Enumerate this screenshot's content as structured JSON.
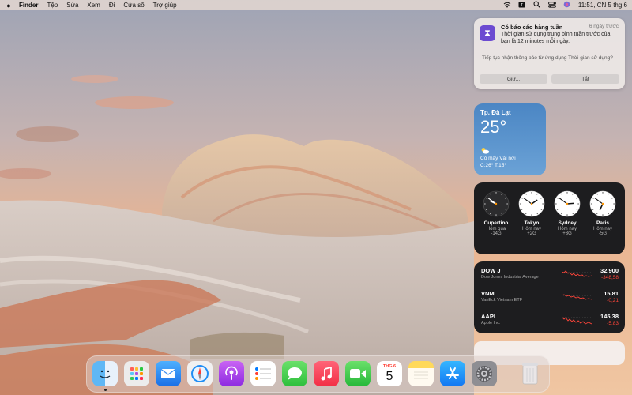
{
  "menubar": {
    "apple_icon": "apple-icon",
    "app_name": "Finder",
    "menus": [
      "Tệp",
      "Sửa",
      "Xem",
      "Đi",
      "Cửa sổ",
      "Trợ giúp"
    ],
    "status_icons": [
      "wifi-icon",
      "search-icon",
      "control-center-icon",
      "siri-icon"
    ],
    "clock": "11:51, CN 5 thg 6"
  },
  "notification": {
    "app_icon": "screen-time-icon",
    "title": "Có báo cáo hàng tuần",
    "time": "6 ngày trước",
    "body": "Thời gian sử dụng trung bình tuần trước của bạn là 12 minutes mỗi ngày.",
    "question": "Tiếp tục nhận thông báo từ ứng dụng Thời gian sử dụng?",
    "keep_label": "Giữ...",
    "off_label": "Tắt"
  },
  "weather": {
    "city": "Tp. Đà Lạt",
    "temperature": "25°",
    "condition_icon": "partly-cloudy-icon",
    "condition": "Có mây Vài nơi",
    "range": "C:26° T:15°"
  },
  "world_clock": [
    {
      "city": "Cupertino",
      "day": "Hôm qua",
      "offset": "-14G",
      "hour": 21,
      "minute": 51
    },
    {
      "city": "Tokyo",
      "day": "Hôm nay",
      "offset": "+2G",
      "hour": 13,
      "minute": 51
    },
    {
      "city": "Sydney",
      "day": "Hôm nay",
      "offset": "+3G",
      "hour": 14,
      "minute": 51
    },
    {
      "city": "Paris",
      "day": "Hôm nay",
      "offset": "-5G",
      "hour": 6,
      "minute": 51
    }
  ],
  "stocks": [
    {
      "symbol": "DOW J",
      "name": "Dow Jones Industrial Average",
      "price": "32.900",
      "change": "-348,58"
    },
    {
      "symbol": "VNM",
      "name": "VanEck Vietnam ETF",
      "price": "15,81",
      "change": "-0,21"
    },
    {
      "symbol": "AAPL",
      "name": "Apple Inc.",
      "price": "145,38",
      "change": "-5,83"
    }
  ],
  "dock": {
    "calendar_month": "THG 6",
    "calendar_day": "5",
    "apps": [
      "finder-icon",
      "launchpad-icon",
      "mail-icon",
      "safari-icon",
      "podcasts-icon",
      "reminders-icon",
      "messages-icon",
      "music-icon",
      "facetime-icon",
      "calendar-icon",
      "notes-icon",
      "app-store-icon",
      "system-preferences-icon",
      "trash-icon"
    ]
  },
  "colors": {
    "widget_dark": "#1d1d1f",
    "weather_blue": "#4b86c4",
    "stock_down": "#ff453a",
    "screen_time_purple": "#6c4bd1"
  }
}
